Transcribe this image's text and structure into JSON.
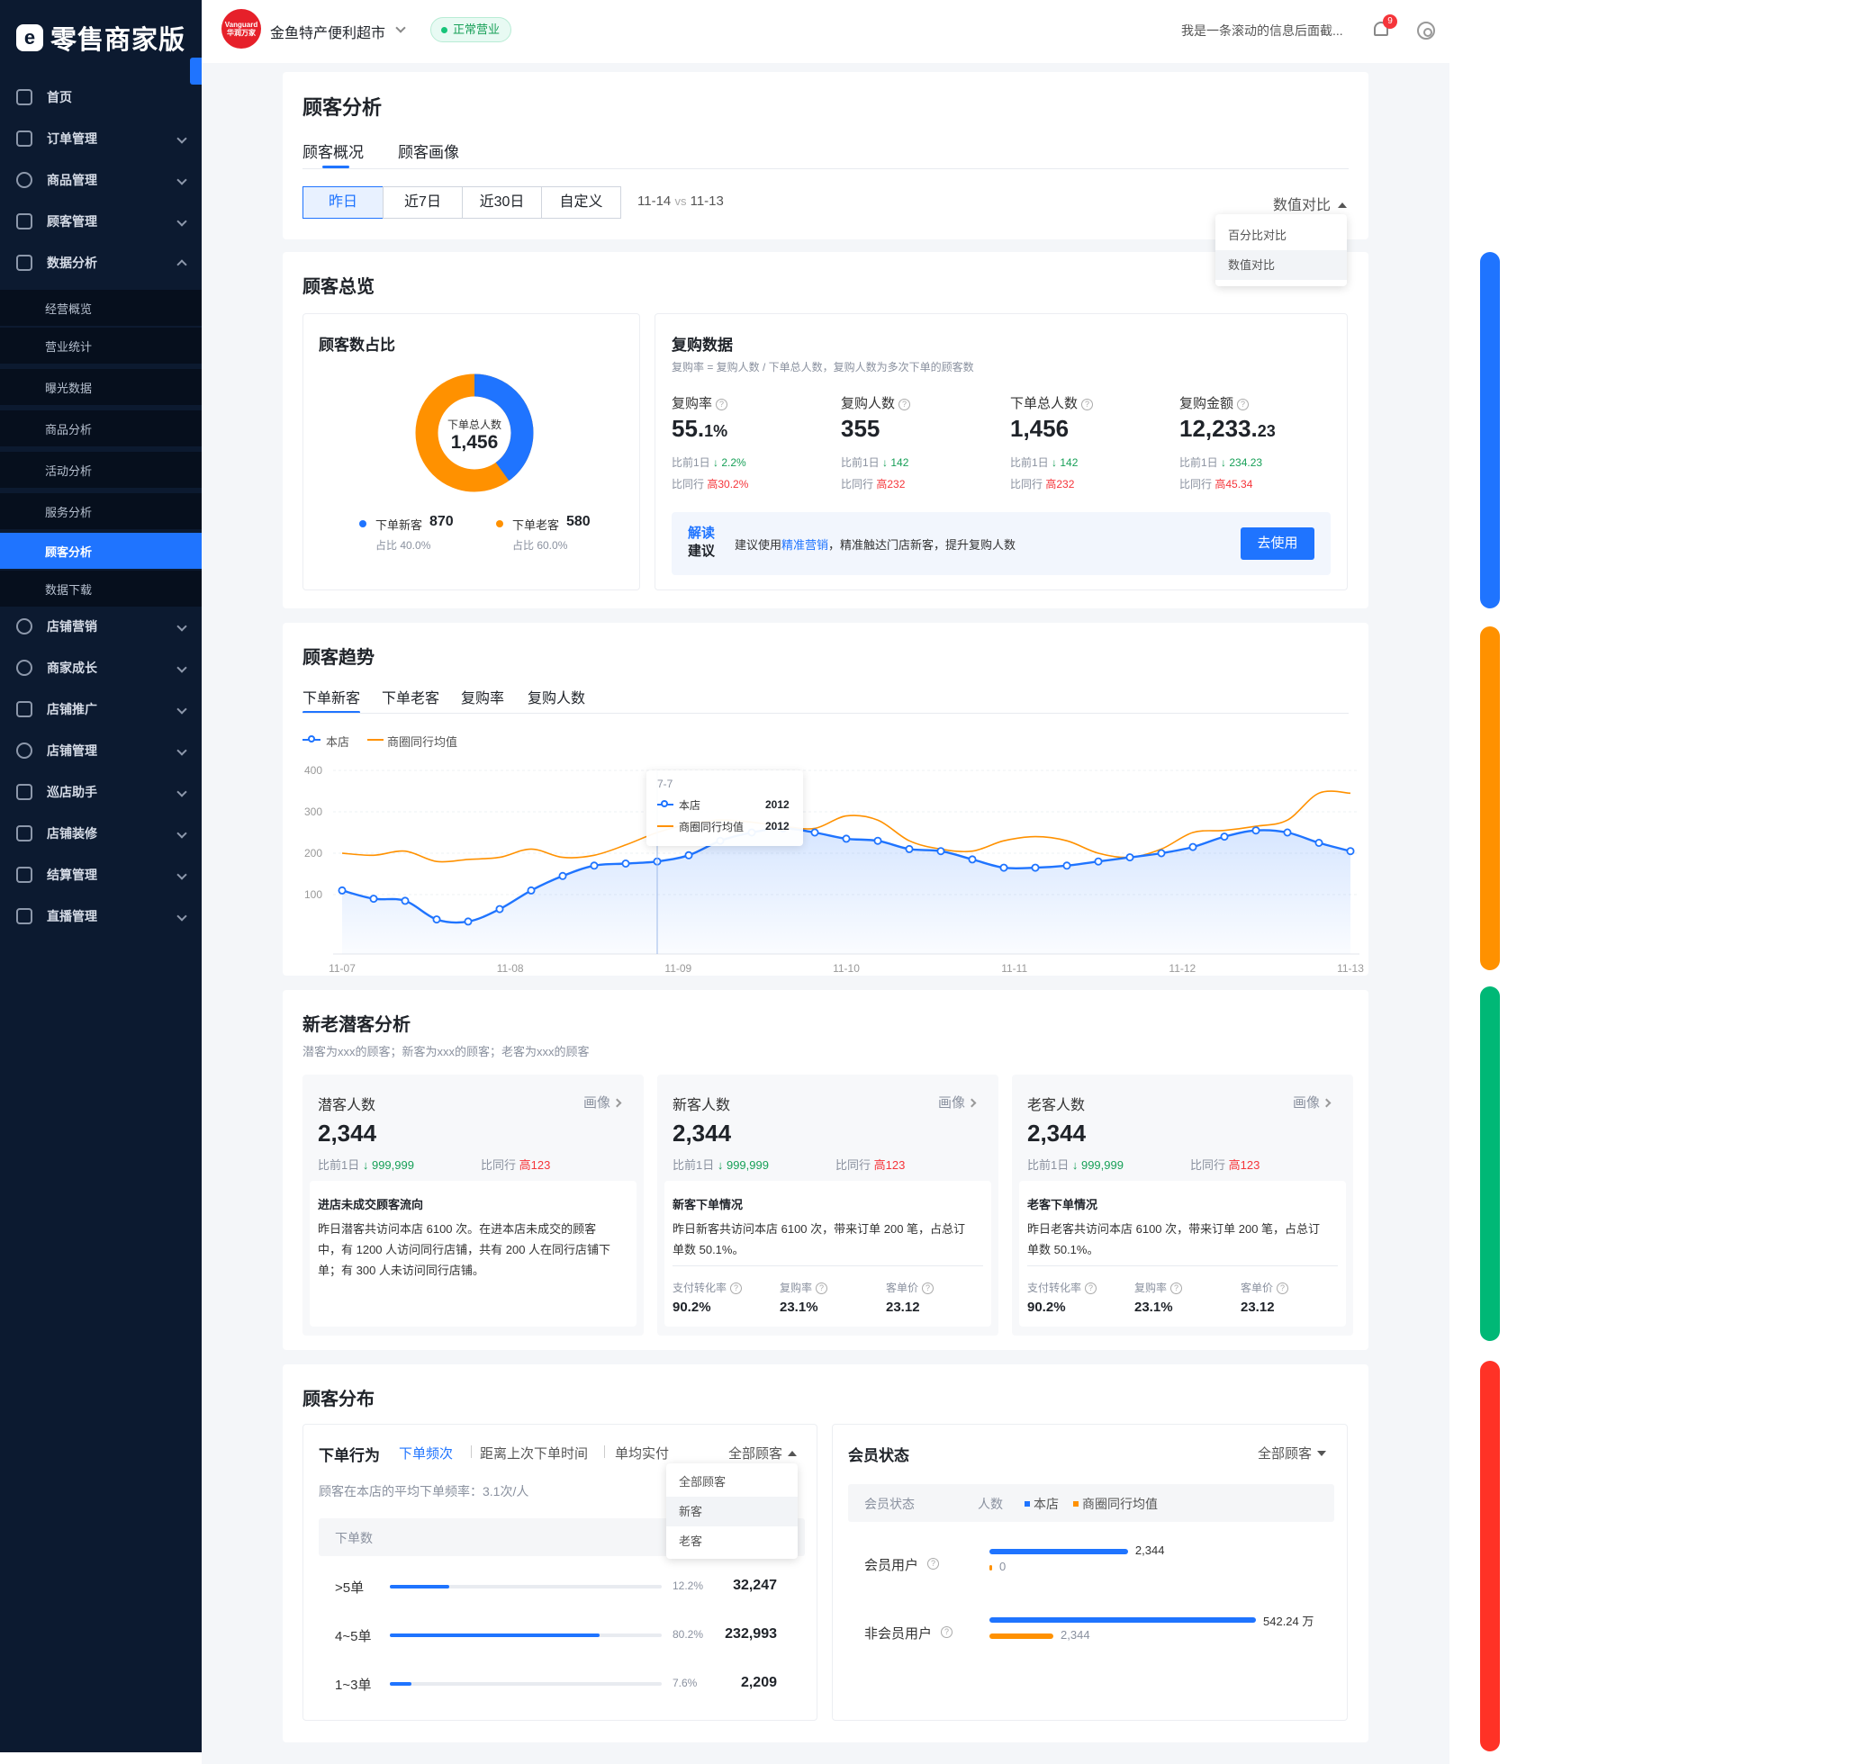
{
  "app": {
    "brand_name": "零售商家版",
    "brand_mark": "e"
  },
  "sidebar": {
    "items": [
      {
        "label": "首页",
        "icon": "home-icon"
      },
      {
        "label": "订单管理",
        "icon": "order-icon"
      },
      {
        "label": "商品管理",
        "icon": "product-icon"
      },
      {
        "label": "顾客管理",
        "icon": "customer-icon"
      },
      {
        "label": "数据分析",
        "icon": "analytics-icon"
      },
      {
        "label": "店铺营销",
        "icon": "marketing-icon"
      },
      {
        "label": "商家成长",
        "icon": "growth-icon"
      },
      {
        "label": "店铺推广",
        "icon": "promote-icon"
      },
      {
        "label": "店铺管理",
        "icon": "store-settings-icon"
      },
      {
        "label": "巡店助手",
        "icon": "inspect-icon"
      },
      {
        "label": "店铺装修",
        "icon": "decorate-icon"
      },
      {
        "label": "结算管理",
        "icon": "settlement-icon"
      },
      {
        "label": "直播管理",
        "icon": "live-icon"
      }
    ],
    "sub_items": [
      "经营概览",
      "营业统计",
      "曝光数据",
      "商品分析",
      "活动分析",
      "服务分析",
      "顾客分析",
      "数据下载"
    ],
    "active_sub": "顾客分析"
  },
  "header": {
    "store_logo_line1": "Vanguard",
    "store_logo_line2": "华润万家",
    "store_name": "金鱼特产便利超市",
    "status": "正常营业",
    "ticker": "我是一条滚动的信息后面截...",
    "notification_count": "9"
  },
  "analysis": {
    "title": "顾客分析",
    "tabs": [
      "顾客概况",
      "顾客画像"
    ],
    "active_tab": "顾客概况",
    "ranges": [
      "昨日",
      "近7日",
      "近30日",
      "自定义"
    ],
    "active_range": "昨日",
    "date_current": "11-14",
    "date_vs": "vs",
    "date_compare": "11-13",
    "compare_mode": "数值对比",
    "compare_options": [
      "百分比对比",
      "数值对比"
    ]
  },
  "overview": {
    "title": "顾客总览",
    "ratio": {
      "title": "顾客数占比",
      "center_label": "下单总人数",
      "center_value": "1,456",
      "new_label": "下单新客",
      "new_value": "870",
      "new_pct": "占比 40.0%",
      "old_label": "下单老客",
      "old_value": "580",
      "old_pct": "占比 60.0%",
      "new_share": 0.4,
      "colors": {
        "new": "#1f74ff",
        "old": "#ff9100"
      }
    },
    "repurchase": {
      "title": "复购数据",
      "formula": "复购率 = 复购人数 / 下单总人数，复购人数为多次下单的顾客数",
      "metrics": [
        {
          "label": "复购率",
          "value_main": "55.",
          "value_small": "1%",
          "cmp1_label": "比前1日",
          "cmp1_value": "↓ 2.2%",
          "cmp2_label": "比同行",
          "cmp2_value": "高30.2%"
        },
        {
          "label": "复购人数",
          "value_main": "355",
          "value_small": "",
          "cmp1_label": "比前1日",
          "cmp1_value": "↓ 142",
          "cmp2_label": "比同行",
          "cmp2_value": "高232"
        },
        {
          "label": "下单总人数",
          "value_main": "1,456",
          "value_small": "",
          "cmp1_label": "比前1日",
          "cmp1_value": "↓ 142",
          "cmp2_label": "比同行",
          "cmp2_value": "高232"
        },
        {
          "label": "复购金额",
          "value_main": "12,233.",
          "value_small": "23",
          "cmp1_label": "比前1日",
          "cmp1_value": "↓ 234.23",
          "cmp2_label": "比同行",
          "cmp2_value": "高45.34"
        }
      ],
      "tip_tag_1": "解读",
      "tip_tag_2": "建议",
      "tip_prefix": "建议使用",
      "tip_link": "精准营销",
      "tip_suffix": "，精准触达门店新客，提升复购人数",
      "tip_button": "去使用"
    }
  },
  "trend": {
    "title": "顾客趋势",
    "tabs": [
      "下单新客",
      "下单老客",
      "复购率",
      "复购人数"
    ],
    "active_tab": "下单新客",
    "legend": [
      "本店",
      "商圈同行均值"
    ],
    "tooltip": {
      "date": "7-7",
      "rows": [
        {
          "name": "本店",
          "value": "2012"
        },
        {
          "name": "商圈同行均值",
          "value": "2012"
        }
      ]
    }
  },
  "chart_data": {
    "type": "line",
    "title": "",
    "xlabel": "",
    "ylabel": "",
    "x_ticks": [
      "11-07",
      "11-08",
      "11-09",
      "11-10",
      "11-11",
      "11-12",
      "11-13"
    ],
    "y_ticks": [
      100,
      200,
      300,
      400
    ],
    "ylim": [
      0,
      400
    ],
    "series": [
      {
        "name": "本店",
        "color": "#1f74ff",
        "values": [
          110,
          90,
          85,
          40,
          35,
          65,
          110,
          145,
          170,
          175,
          180,
          195,
          230,
          250,
          260,
          250,
          235,
          230,
          210,
          205,
          185,
          165,
          165,
          170,
          180,
          190,
          200,
          215,
          240,
          255,
          250,
          225,
          205
        ]
      },
      {
        "name": "商圈同行均值",
        "color": "#ff9100",
        "values": [
          200,
          195,
          205,
          180,
          185,
          190,
          210,
          190,
          195,
          220,
          250,
          270,
          280,
          275,
          265,
          260,
          290,
          280,
          230,
          210,
          205,
          230,
          240,
          230,
          200,
          190,
          210,
          250,
          255,
          265,
          280,
          345,
          345
        ]
      }
    ]
  },
  "segments": {
    "title": "新老潜客分析",
    "subtitle": "潜客为xxx的顾客；新客为xxx的顾客；老客为xxx的顾客",
    "portrait_label": "画像",
    "cards": [
      {
        "title": "潜客人数",
        "value": "2,344",
        "cmp1_label": "比前1日",
        "cmp1_value": "↓ 999,999",
        "cmp2_label": "比同行",
        "cmp2_value": "高123",
        "detail_title": "进店未成交顾客流向",
        "detail_lines": [
          "昨日潜客共访问本店 6100 次。在进本店未成交的顾客",
          "中，有 1200 人访问同行店铺，共有 200 人在同行店铺下",
          "单；有 300 人未访问同行店铺。"
        ],
        "metrics": []
      },
      {
        "title": "新客人数",
        "value": "2,344",
        "cmp1_label": "比前1日",
        "cmp1_value": "↓ 999,999",
        "cmp2_label": "比同行",
        "cmp2_value": "高123",
        "detail_title": "新客下单情况",
        "detail_lines": [
          "昨日新客共访问本店 6100 次，带来订单 200 笔，占总订",
          "单数 50.1%。"
        ],
        "metrics": [
          {
            "label": "支付转化率",
            "value": "90.2%"
          },
          {
            "label": "复购率",
            "value": "23.1%"
          },
          {
            "label": "客单价",
            "value": "23.12"
          }
        ]
      },
      {
        "title": "老客人数",
        "value": "2,344",
        "cmp1_label": "比前1日",
        "cmp1_value": "↓ 999,999",
        "cmp2_label": "比同行",
        "cmp2_value": "高123",
        "detail_title": "老客下单情况",
        "detail_lines": [
          "昨日老客共访问本店 6100 次，带来订单 200 笔，占总订",
          "单数 50.1%。"
        ],
        "metrics": [
          {
            "label": "支付转化率",
            "value": "90.2%"
          },
          {
            "label": "复购率",
            "value": "23.1%"
          },
          {
            "label": "客单价",
            "value": "23.12"
          }
        ]
      }
    ]
  },
  "distribution": {
    "title": "顾客分布",
    "behavior": {
      "title": "下单行为",
      "tabs": [
        "下单频次",
        "距离上次下单时间",
        "单均实付"
      ],
      "active_tab": "下单频次",
      "filter": "全部顾客",
      "filter_options": [
        "全部顾客",
        "新客",
        "老客"
      ],
      "avg_freq_text": "顾客在本店的平均下单频率：3.1次/人",
      "column_header": "下单数",
      "rows": [
        {
          "label": ">5单",
          "pct_text": "12.2%",
          "pct": 0.22,
          "count": "32,247"
        },
        {
          "label": "4~5单",
          "pct_text": "80.2%",
          "pct": 0.77,
          "count": "232,993"
        },
        {
          "label": "1~3单",
          "pct_text": "7.6%",
          "pct": 0.08,
          "count": "2,209"
        }
      ]
    },
    "member": {
      "title": "会员状态",
      "filter": "全部顾客",
      "header_col1": "会员状态",
      "header_col2": "人数",
      "legend": [
        "本店",
        "商圈同行均值"
      ],
      "rows": [
        {
          "label": "会员用户",
          "store_value": "2,344",
          "store_frac": 0.52,
          "peer_value": "0",
          "peer_frac": 0.0
        },
        {
          "label": "非会员用户",
          "store_value": "542.24 万",
          "store_frac": 1.0,
          "peer_value": "2,344",
          "peer_frac": 0.24
        }
      ]
    }
  },
  "colors": {
    "primary": "#1f74ff",
    "orange": "#ff9100",
    "green": "#00b876",
    "red": "#ff3226",
    "sidebar": "#0c1a30"
  }
}
